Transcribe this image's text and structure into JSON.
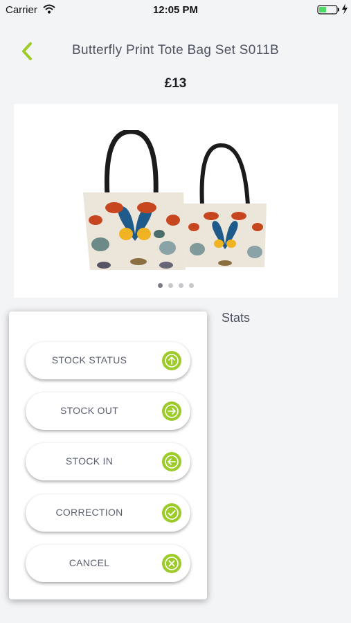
{
  "status_bar": {
    "carrier": "Carrier",
    "time": "12:05 PM"
  },
  "header": {
    "title": "Butterfly Print Tote Bag Set S011B"
  },
  "product": {
    "price": "£13",
    "image_count": 4,
    "active_image": 1
  },
  "tabs": {
    "stats_label": "Stats"
  },
  "action_menu": {
    "items": [
      {
        "label": "STOCK STATUS",
        "icon": "arrow-up-icon"
      },
      {
        "label": "STOCK OUT",
        "icon": "arrow-right-icon"
      },
      {
        "label": "STOCK IN",
        "icon": "arrow-left-icon"
      },
      {
        "label": "CORRECTION",
        "icon": "check-icon"
      },
      {
        "label": "CANCEL",
        "icon": "close-icon"
      }
    ]
  },
  "colors": {
    "accent": "#9ccb2a",
    "background": "#f3f4f6",
    "text": "#4d5260"
  }
}
